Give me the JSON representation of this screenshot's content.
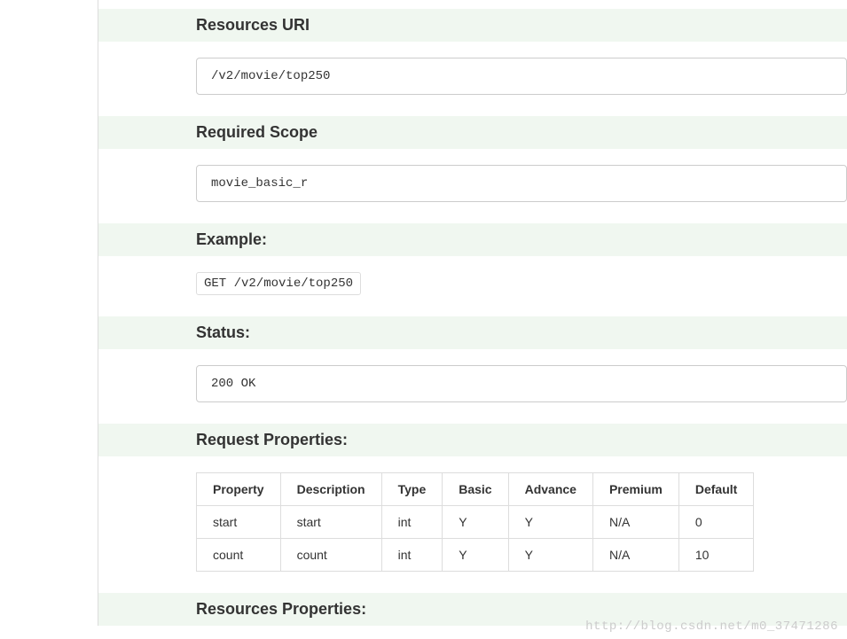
{
  "sections": {
    "resources_uri": {
      "heading": "Resources URI",
      "code": "/v2/movie/top250"
    },
    "required_scope": {
      "heading": "Required Scope",
      "code": "movie_basic_r"
    },
    "example": {
      "heading": "Example:",
      "code": "GET /v2/movie/top250"
    },
    "status": {
      "heading": "Status:",
      "code": "200 OK"
    },
    "request_properties": {
      "heading": "Request Properties:",
      "headers": [
        "Property",
        "Description",
        "Type",
        "Basic",
        "Advance",
        "Premium",
        "Default"
      ],
      "rows": [
        [
          "start",
          "start",
          "int",
          "Y",
          "Y",
          "N/A",
          "0"
        ],
        [
          "count",
          "count",
          "int",
          "Y",
          "Y",
          "N/A",
          "10"
        ]
      ]
    },
    "resources_properties": {
      "heading": "Resources Properties:"
    }
  },
  "watermark": "http://blog.csdn.net/m0_37471286"
}
